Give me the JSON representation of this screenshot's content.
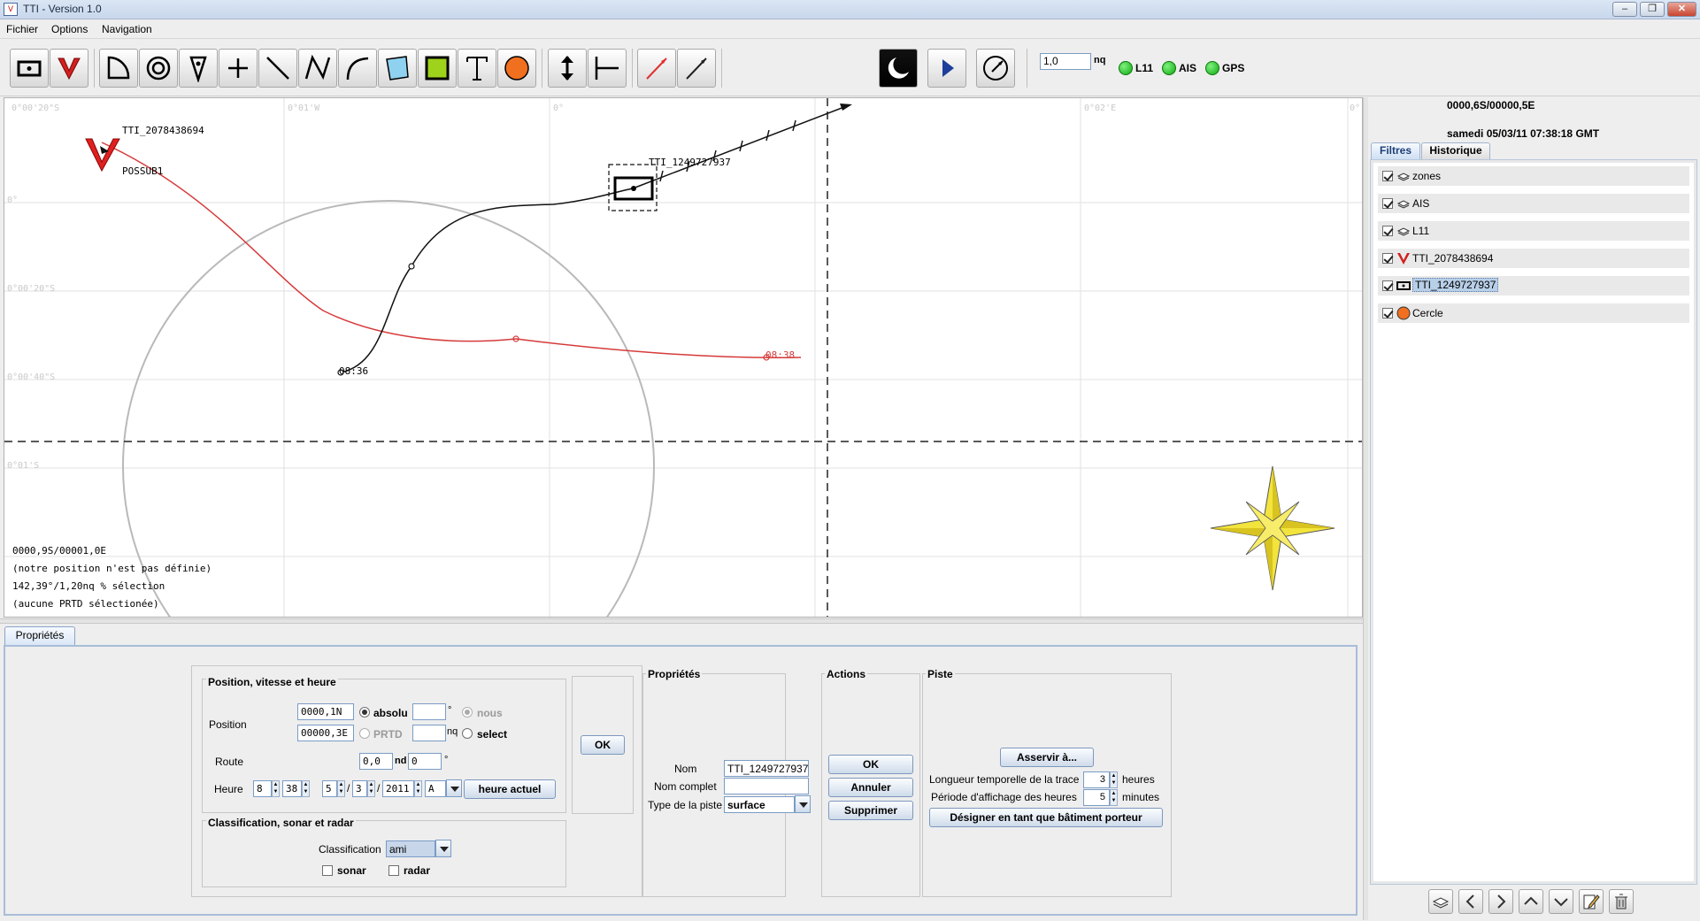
{
  "window": {
    "title": "TTI - Version 1.0",
    "app_icon_glyph": "V",
    "min_glyph": "–",
    "max_glyph": "❐",
    "close_glyph": "✕"
  },
  "menu": {
    "fichier": "Fichier",
    "options": "Options",
    "navigation": "Navigation"
  },
  "toolbar": {
    "tools": [
      "own-ship-icon",
      "submarine-v-icon",
      "sector-icon",
      "concentric-circles-icon",
      "drop-marker-icon",
      "cross-icon",
      "line-icon",
      "polyline-icon",
      "arc-icon",
      "polygon-icon",
      "square-zone-icon",
      "text-icon",
      "circle-icon",
      "vertical-arrow-icon",
      "measure-icon",
      "red-bearing-icon",
      "black-bearing-icon",
      "night-mode-icon",
      "play-icon",
      "compass-dial-icon"
    ],
    "scale_value": "1,0",
    "scale_unit": "nq",
    "status": [
      {
        "label": "L11",
        "color": "#12b312"
      },
      {
        "label": "AIS",
        "color": "#12b312"
      },
      {
        "label": "GPS",
        "color": "#12b312"
      }
    ]
  },
  "map": {
    "grid_labels": {
      "top_left_lon": "0°02'W",
      "top_w1": "0°01'W",
      "top_zero": "0°",
      "top_e2": "0°02'E",
      "top_right": "0°",
      "lat_top": "0°00'20\"S",
      "lat_zero": "0°",
      "lat_20": "0°00'20\"S",
      "lat_40": "0°00'40\"S",
      "lat_1": "0°01'S"
    },
    "labels": {
      "track_tti_2078": "TTI_2078438694",
      "possub": "POSSUB1",
      "track_tti_1249": "TTI_1249727937",
      "time_black": "08:36",
      "time_red": "08:38"
    },
    "info": {
      "cursor_pos": "0000,9S/00001,0E",
      "own_position": "(notre position n'est pas définie)",
      "bearing_selection": "142,39°/1,20nq % sélection",
      "prtd": "(aucune PRTD sélectionée)"
    }
  },
  "properties": {
    "tab": "Propriétés",
    "position_group": {
      "title": "Position, vitesse et heure",
      "position_label": "Position",
      "lat": "0000,1N",
      "lon": "00000,3E",
      "absolu_label": "absolu",
      "prtd_label": "PRTD",
      "deg_unit": "°",
      "nq_unit": "nq",
      "nous_label": "nous",
      "select_label": "select",
      "route_label": "Route",
      "route_value": "0,0",
      "route_unit": "nd",
      "route_deg": "0",
      "heure_label": "Heure",
      "hour": "8",
      "minute": "38",
      "day": "5",
      "month": "3",
      "year": "2011",
      "ampm": "A",
      "heure_actuel_button": "heure actuel",
      "ok_button": "OK",
      "sep": "/"
    },
    "classification_group": {
      "title": "Classification, sonar et radar",
      "classification_label": "Classification",
      "classification_value": "ami",
      "sonar_label": "sonar",
      "radar_label": "radar"
    },
    "proprietes_group": {
      "title": "Propriétés",
      "nom_label": "Nom",
      "nom_value": "TTI_1249727937",
      "nom_complet_label": "Nom complet",
      "nom_complet_value": "",
      "type_label": "Type de la piste",
      "type_value": "surface"
    },
    "actions_group": {
      "title": "Actions",
      "ok": "OK",
      "annuler": "Annuler",
      "supprimer": "Supprimer"
    },
    "piste_group": {
      "title": "Piste",
      "asservir": "Asservir à...",
      "longueur_label": "Longueur temporelle de la trace",
      "longueur_value": "3",
      "longueur_unit": "heures",
      "periode_label": "Période d'affichage des heures",
      "periode_value": "5",
      "periode_unit": "minutes",
      "designer": "Désigner en tant que bâtiment porteur"
    }
  },
  "right_panel": {
    "coords": "0000,6S/00000,5E",
    "datetime": "samedi 05/03/11 07:38:18 GMT",
    "tab_filtres": "Filtres",
    "tab_historique": "Historique",
    "filters": [
      {
        "label": "zones",
        "icon": "layer-icon",
        "checked": true
      },
      {
        "label": "AIS",
        "icon": "layer-icon",
        "checked": true
      },
      {
        "label": "L11",
        "icon": "layer-icon",
        "checked": true
      },
      {
        "label": "TTI_2078438694",
        "icon": "submarine-v-icon",
        "checked": true
      },
      {
        "label": "TTI_1249727937",
        "icon": "own-ship-icon",
        "checked": true,
        "selected": true
      },
      {
        "label": "Cercle",
        "icon": "orange-circle-icon",
        "checked": true
      }
    ],
    "bottom_icons": [
      "layer-add-icon",
      "arrow-left-icon",
      "arrow-right-icon",
      "arrow-up-icon",
      "arrow-down-icon",
      "edit-icon",
      "trash-icon"
    ]
  }
}
